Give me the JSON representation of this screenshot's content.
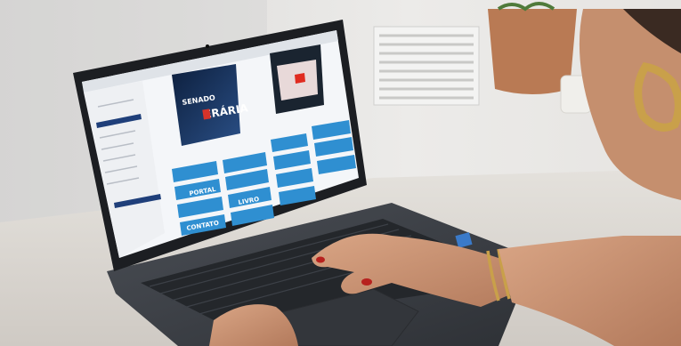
{
  "photo": {
    "colors": {
      "wall": "#e4e3e1",
      "desk": "#dcd8d3",
      "laptop_body": "#3b3e44",
      "screen_bezel": "#1c1e22",
      "screen_bg": "#f4f6f9",
      "tile_blue": "#2f8fd1",
      "video_dark": "#152a4e",
      "skin": "#c99273",
      "nail": "#b7211e",
      "gold": "#c9a04a",
      "pot": "#b97a54"
    },
    "screen_text": {
      "video1_title": "SENADO",
      "video1_caption": "ERÁRIA",
      "tiles": [
        "PORTAL",
        "LIVRO",
        "CONTATO"
      ]
    }
  }
}
